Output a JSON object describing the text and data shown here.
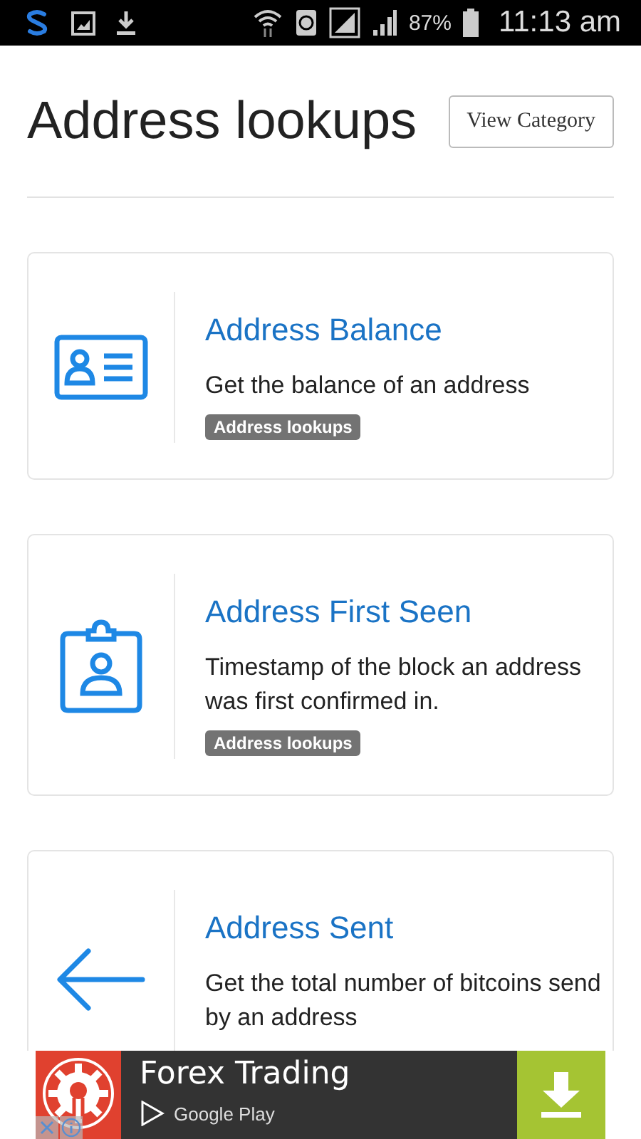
{
  "status_bar": {
    "battery": "87%",
    "time": "11:13 am"
  },
  "header": {
    "title": "Address lookups",
    "button": "View Category"
  },
  "cards": [
    {
      "kind": "id-card",
      "title": "Address Balance",
      "description": "Get the balance of an address",
      "tag": "Address lookups"
    },
    {
      "kind": "clipboard-person",
      "title": "Address First Seen",
      "description": "Timestamp of the block an address was first confirmed in.",
      "tag": "Address lookups"
    },
    {
      "kind": "arrow-left",
      "title": "Address Sent",
      "description": "Get the total number of bitcoins send by an address"
    }
  ],
  "ad": {
    "title": "Forex Trading",
    "store": "Google Play"
  }
}
